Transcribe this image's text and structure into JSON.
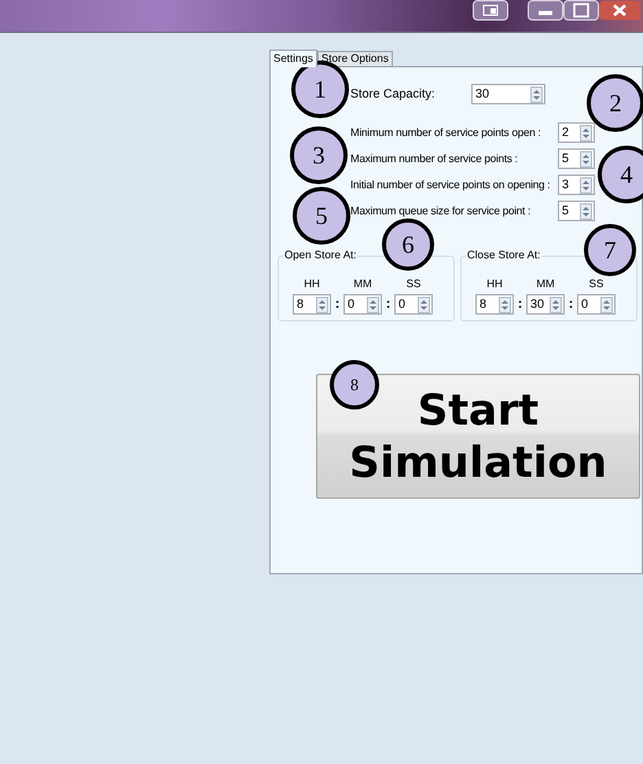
{
  "tabs": [
    {
      "label": "Settings",
      "selected": true
    },
    {
      "label": "Store Options",
      "selected": false
    }
  ],
  "store_capacity": {
    "label": "Store Capacity:",
    "value": "30"
  },
  "service_settings": [
    {
      "label": "Minimum number of service points open :",
      "value": "2"
    },
    {
      "label": "Maximum number of service points :",
      "value": "5"
    },
    {
      "label": "Initial number of service points on opening :",
      "value": "3"
    },
    {
      "label": "Maximum queue size for service point :",
      "value": "5"
    }
  ],
  "time_groups": [
    {
      "title": "Open Store At:",
      "separator": ":",
      "fields": [
        {
          "label": "HH",
          "value": "8"
        },
        {
          "label": "MM",
          "value": "0"
        },
        {
          "label": "SS",
          "value": "0"
        }
      ]
    },
    {
      "title": "Close Store At:",
      "separator": ":",
      "fields": [
        {
          "label": "HH",
          "value": "8"
        },
        {
          "label": "MM",
          "value": "30"
        },
        {
          "label": "SS",
          "value": "0"
        }
      ]
    }
  ],
  "start_button": [
    "Start",
    "Simulation"
  ],
  "callouts": [
    "1",
    "2",
    "3",
    "4",
    "5",
    "6",
    "7",
    "8"
  ]
}
